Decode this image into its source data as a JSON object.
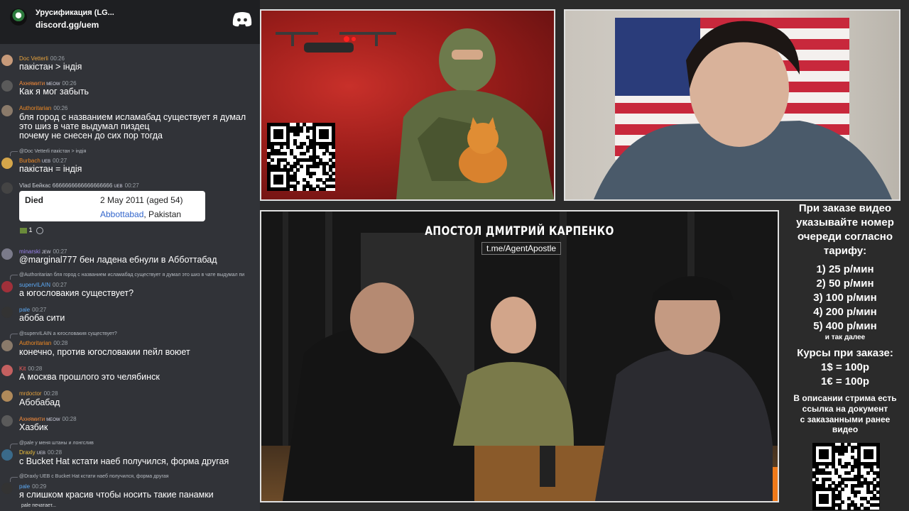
{
  "server": {
    "name": "Урусификация (LG...",
    "invite": "discord.gg/uem"
  },
  "messages": [
    {
      "user": "Doc Vetterli",
      "time": "00:26",
      "user_color": "#e6a23c",
      "text": "пакістан > індія"
    },
    {
      "user": "Ахнямити",
      "badge": "MEOW",
      "time": "00:26",
      "user_color": "#f38a3a",
      "text": "Как я мог забыть"
    },
    {
      "user": "Authoritarian",
      "time": "00:26",
      "user_color": "#f08a24",
      "text": "бля город с названием исламабад существует я думал",
      "text2": "это шиз в чате выдумал пиздец",
      "text3": "почему не снесен до сих пор тогда"
    },
    {
      "reply": "@Doc Vetterli пакістан > індія",
      "user": "Burbach",
      "badge": "UEB",
      "time": "00:27",
      "user_color": "#f08a24",
      "text": "пакістан = індія"
    },
    {
      "user": "Vlad Бейкас",
      "spam": "6666666666666666666",
      "badge": "UEB",
      "time": "00:27",
      "user_color": "#c9cdd4"
    },
    {
      "user": "minarski",
      "badge": "JEW",
      "time": "00:27",
      "user_color": "#9b84ee",
      "text": "@marginal777 бен ладена ебнули в Абботтабад"
    },
    {
      "reply": "@Authoritarian бля город с названием исламабад существует я думал это шиз в чате выдумал пи",
      "user": "supervILAIN",
      "time": "00:27",
      "user_color": "#5ca9f5",
      "text": "а югословакия существует?"
    },
    {
      "user": "pale",
      "time": "00:27",
      "user_color": "#5ca9f5",
      "text": "абоба сити"
    },
    {
      "reply": "@supervILAIN а югословакия существует?",
      "user": "Authoritarian",
      "time": "00:28",
      "user_color": "#f08a24",
      "text": "конечно, против югословакии пейл воюет"
    },
    {
      "user": "Kit",
      "time": "00:28",
      "user_color": "#f25c5c",
      "text": "А москва прошлого это челябинск"
    },
    {
      "user": "mrdoctor",
      "time": "00:28",
      "user_color": "#e6a23c",
      "text": "Абобабад"
    },
    {
      "user": "Ахнямити",
      "badge": "MEOW",
      "time": "00:28",
      "user_color": "#f38a3a",
      "text": "Хазбик"
    },
    {
      "reply": "@pale у меня штаны и лонгслив",
      "user": "Draxly",
      "badge": "UEB",
      "time": "00:28",
      "user_color": "#f0c23c",
      "text": "с Bucket Hat кстати наеб получился, форма другая"
    },
    {
      "reply": "@Draxly UEB с Bucket Hat кстати наеб получился, форма другая",
      "user": "pale",
      "time": "00:29",
      "user_color": "#5ca9f5",
      "text": "я слишком красив чтобы носить такие панамки"
    }
  ],
  "embed": {
    "label": "Died",
    "date": "2 May 2011 (aged 54)",
    "place_link": "Abbottabad",
    "place_rest": ", Pakistan"
  },
  "reaction": {
    "count": "1"
  },
  "typing": "pale печатает...",
  "podcast": {
    "title": "АПОСТОЛ ДМИТРИЙ КАРПЕНКО",
    "link": "t.me/AgentApostle"
  },
  "info": {
    "intro": [
      "При заказе видео",
      "указывайте номер",
      "очереди согласно",
      "тарифу:"
    ],
    "tariffs": [
      "1) 25 р/мин",
      "2) 50 р/мин",
      "3) 100 р/мин",
      "4) 200 р/мин",
      "5) 400 р/мин"
    ],
    "tariffs_more": "и так далее",
    "rates_title": "Курсы при заказе:",
    "rates": [
      "1$ = 100р",
      "1€ = 100р"
    ],
    "description": [
      "В описании стрима есть",
      "ссылка на документ",
      "с заказанными ранее",
      "видео"
    ]
  },
  "colors": {
    "chat_bg": "#313338",
    "header_bg": "#1e1f22",
    "page_bg": "#2b2b2b",
    "link": "#3366cc"
  }
}
